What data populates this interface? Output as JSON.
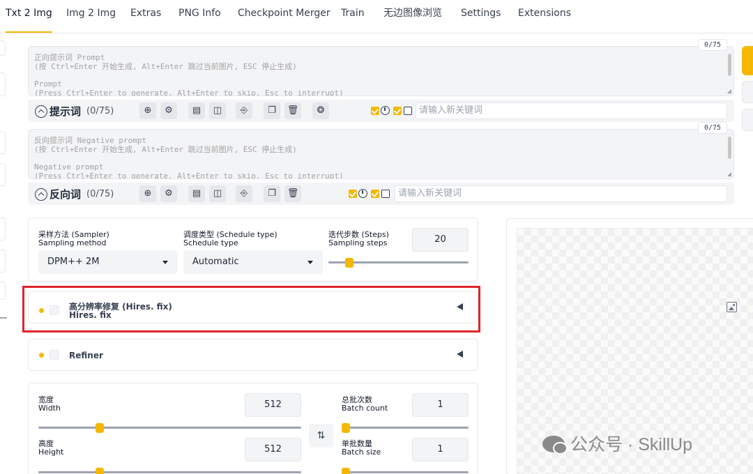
{
  "tabs": [
    "Txt 2 Img",
    "Img 2 Img",
    "Extras",
    "PNG Info",
    "Checkpoint Merger",
    "Train",
    "无边图像浏览",
    "Settings",
    "Extensions"
  ],
  "active_tab": "Txt 2 Img",
  "positive": {
    "counter": "0/75",
    "placeholder_line1": "正向提示词 Prompt",
    "placeholder_line2": "(按 Ctrl+Enter 开始生成, Alt+Enter 跳过当前图片, ESC 停止生成)",
    "placeholder_line3": "Prompt",
    "placeholder_line4": "(Press Ctrl+Enter to generate, Alt+Enter to skip, Esc to interrupt)",
    "title": "提示词",
    "count": "(0/75)",
    "keyword_placeholder": "请输入新关键词"
  },
  "negative": {
    "counter": "0/75",
    "placeholder_line1": "反向提示词 Negative prompt",
    "placeholder_line2": "(按 Ctrl+Enter 开始生成, Alt+Enter 跳过当前图片, ESC 停止生成)",
    "placeholder_line3": "Negative prompt",
    "placeholder_line4": "(Press Ctrl+Enter to generate, Alt+Enter to skip, Esc to interrupt)",
    "title": "反向词",
    "count": "(0/75)",
    "keyword_placeholder": "请输入新关键词"
  },
  "sampler": {
    "label_cn": "采样方法 (Sampler)",
    "label_en": "Sampling method",
    "value": "DPM++ 2M"
  },
  "schedule": {
    "label_cn": "调度类型 (Schedule type)",
    "label_en": "Schedule type",
    "value": "Automatic"
  },
  "steps": {
    "label_cn": "迭代步数 (Steps)",
    "label_en": "Sampling steps",
    "value": "20"
  },
  "hires": {
    "title_cn": "高分辨率修复 (Hires. fix)",
    "title_en": "Hires. fix"
  },
  "refiner": {
    "title": "Refiner"
  },
  "width": {
    "label_cn": "宽度",
    "label_en": "Width",
    "value": "512"
  },
  "height": {
    "label_cn": "高度",
    "label_en": "Height",
    "value": "512"
  },
  "batch_count": {
    "label_cn": "总批次数",
    "label_en": "Batch count",
    "value": "1"
  },
  "batch_size": {
    "label_cn": "单批数量",
    "label_en": "Batch size",
    "value": "1"
  },
  "watermark": "公众号 · SkillUp",
  "colors": {
    "accent": "#f5b800",
    "highlight": "#e0242a"
  }
}
